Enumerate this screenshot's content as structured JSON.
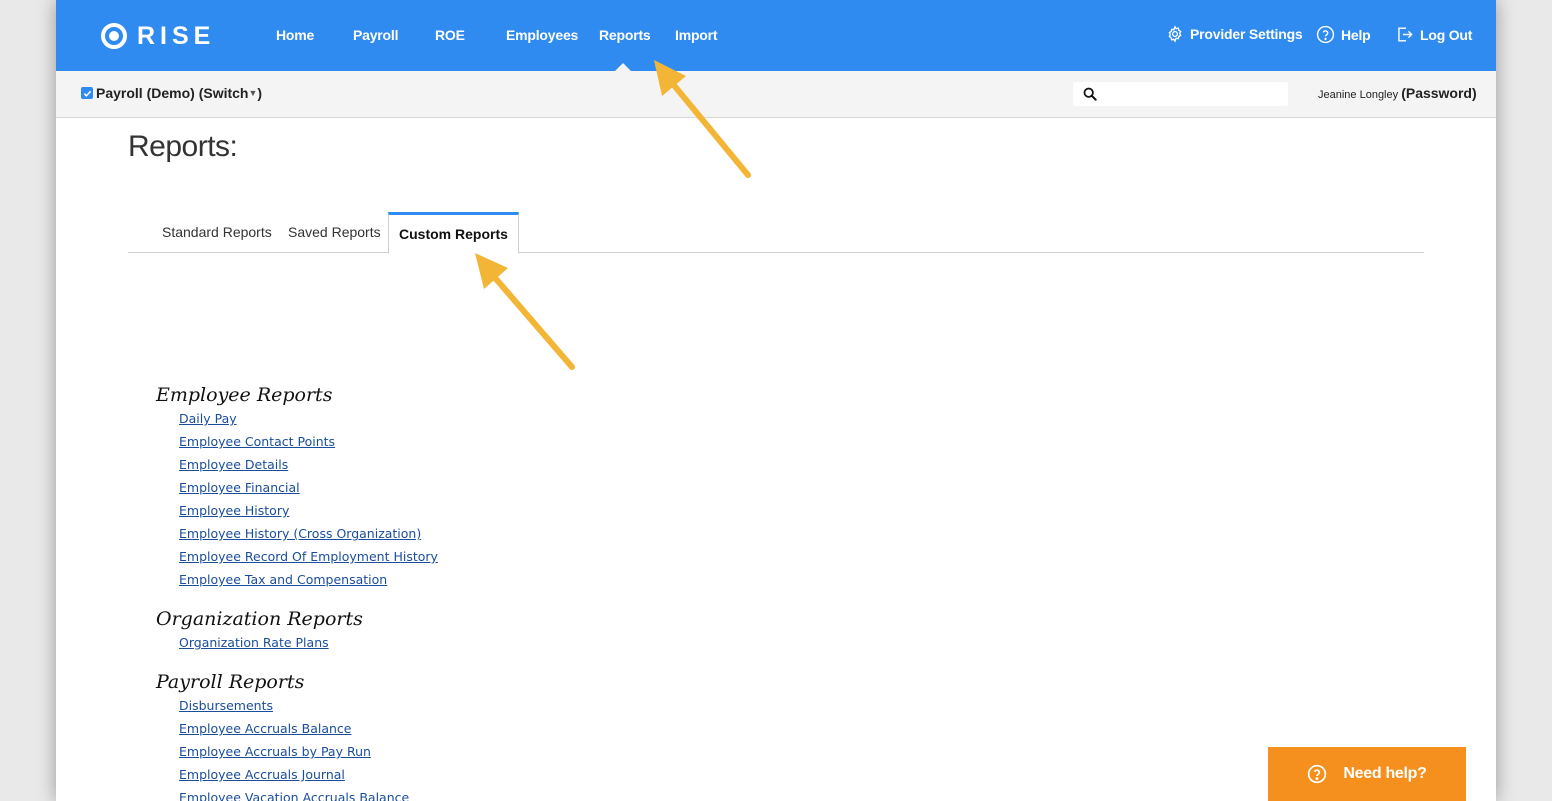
{
  "app": {
    "logo_text": "RISE"
  },
  "nav": {
    "items": [
      {
        "label": "Home"
      },
      {
        "label": "Payroll"
      },
      {
        "label": "ROE"
      },
      {
        "label": "Employees"
      },
      {
        "label": "Reports"
      },
      {
        "label": "Import"
      }
    ],
    "active": "Reports",
    "right": {
      "provider_settings": "Provider Settings",
      "help": "Help",
      "logout": "Log Out"
    }
  },
  "subbar": {
    "org_name": "Payroll (Demo)",
    "switch_label": "(Switch",
    "switch_close": ")",
    "search_placeholder": "",
    "user_name": "Jeanine Longley",
    "password_link": "(Password)"
  },
  "page": {
    "title": "Reports:",
    "tabs": [
      {
        "label": "Standard Reports"
      },
      {
        "label": "Saved Reports"
      },
      {
        "label": "Custom Reports"
      }
    ],
    "active_tab": "Custom Reports",
    "sections": [
      {
        "heading": "Employee Reports",
        "links": [
          "Daily Pay",
          "Employee Contact Points",
          "Employee Details",
          "Employee Financial",
          "Employee History",
          "Employee History (Cross Organization)",
          "Employee Record Of Employment History",
          "Employee Tax and Compensation"
        ]
      },
      {
        "heading": "Organization Reports",
        "links": [
          "Organization Rate Plans"
        ]
      },
      {
        "heading": "Payroll Reports",
        "links": [
          "Disbursements",
          "Employee Accruals Balance",
          "Employee Accruals by Pay Run",
          "Employee Accruals Journal",
          "Employee Vacation Accruals Balance"
        ]
      }
    ]
  },
  "help_widget": {
    "label": "Need help?"
  },
  "colors": {
    "nav_blue": "#2f8bf0",
    "link_blue": "#1a4d9c",
    "help_orange": "#f5901e",
    "annotation_arrow": "#f2b535"
  }
}
